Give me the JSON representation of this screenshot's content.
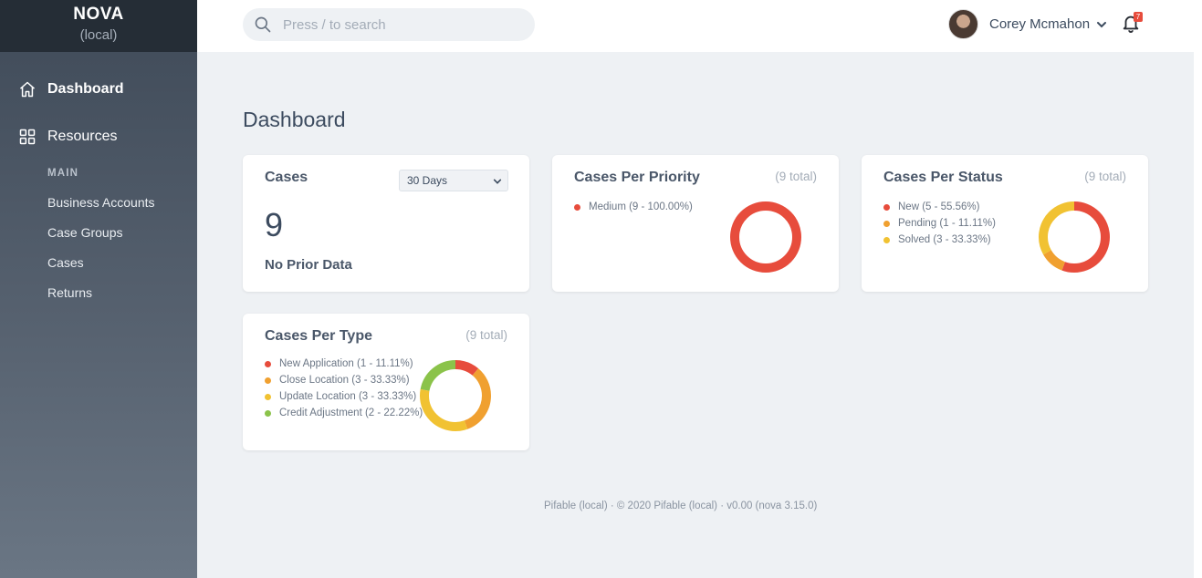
{
  "brand": {
    "name": "NOVA",
    "env": "(local)"
  },
  "sidebar": {
    "dashboard": "Dashboard",
    "resources": "Resources",
    "section": "MAIN",
    "items": [
      "Business Accounts",
      "Case Groups",
      "Cases",
      "Returns"
    ]
  },
  "header": {
    "search_placeholder": "Press / to search",
    "user_name": "Corey Mcmahon",
    "notification_count": "7"
  },
  "page": {
    "title": "Dashboard"
  },
  "cards": {
    "cases": {
      "title": "Cases",
      "range": "30 Days",
      "value": "9",
      "subtext": "No Prior Data"
    },
    "priority": {
      "title": "Cases Per Priority",
      "total": "(9 total)",
      "legend": [
        {
          "label": "Medium (9 - 100.00%)",
          "color": "#e74c3c",
          "value": 9
        }
      ]
    },
    "status": {
      "title": "Cases Per Status",
      "total": "(9 total)",
      "legend": [
        {
          "label": "New (5 - 55.56%)",
          "color": "#e74c3c",
          "value": 5
        },
        {
          "label": "Pending (1 - 11.11%)",
          "color": "#f0a030",
          "value": 1
        },
        {
          "label": "Solved (3 - 33.33%)",
          "color": "#f1c232",
          "value": 3
        }
      ]
    },
    "type": {
      "title": "Cases Per Type",
      "total": "(9 total)",
      "legend": [
        {
          "label": "New Application (1 - 11.11%)",
          "color": "#e74c3c",
          "value": 1
        },
        {
          "label": "Close Location (3 - 33.33%)",
          "color": "#f0a030",
          "value": 3
        },
        {
          "label": "Update Location (3 - 33.33%)",
          "color": "#f1c232",
          "value": 3
        },
        {
          "label": "Credit Adjustment (2 - 22.22%)",
          "color": "#8bc34a",
          "value": 2
        }
      ]
    }
  },
  "footer": "Pifable (local)  ·  © 2020 Pifable (local)  ·  v0.00 (nova 3.15.0)"
}
